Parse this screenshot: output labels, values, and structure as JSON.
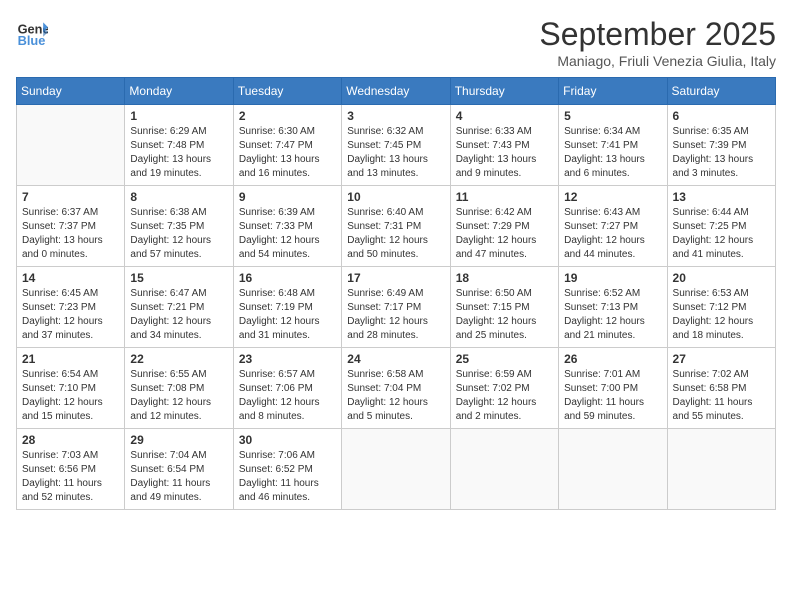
{
  "header": {
    "logo_general": "General",
    "logo_blue": "Blue",
    "month": "September 2025",
    "location": "Maniago, Friuli Venezia Giulia, Italy"
  },
  "days_of_week": [
    "Sunday",
    "Monday",
    "Tuesday",
    "Wednesday",
    "Thursday",
    "Friday",
    "Saturday"
  ],
  "weeks": [
    [
      {
        "day": "",
        "sunrise": "",
        "sunset": "",
        "daylight": ""
      },
      {
        "day": "1",
        "sunrise": "Sunrise: 6:29 AM",
        "sunset": "Sunset: 7:48 PM",
        "daylight": "Daylight: 13 hours and 19 minutes."
      },
      {
        "day": "2",
        "sunrise": "Sunrise: 6:30 AM",
        "sunset": "Sunset: 7:47 PM",
        "daylight": "Daylight: 13 hours and 16 minutes."
      },
      {
        "day": "3",
        "sunrise": "Sunrise: 6:32 AM",
        "sunset": "Sunset: 7:45 PM",
        "daylight": "Daylight: 13 hours and 13 minutes."
      },
      {
        "day": "4",
        "sunrise": "Sunrise: 6:33 AM",
        "sunset": "Sunset: 7:43 PM",
        "daylight": "Daylight: 13 hours and 9 minutes."
      },
      {
        "day": "5",
        "sunrise": "Sunrise: 6:34 AM",
        "sunset": "Sunset: 7:41 PM",
        "daylight": "Daylight: 13 hours and 6 minutes."
      },
      {
        "day": "6",
        "sunrise": "Sunrise: 6:35 AM",
        "sunset": "Sunset: 7:39 PM",
        "daylight": "Daylight: 13 hours and 3 minutes."
      }
    ],
    [
      {
        "day": "7",
        "sunrise": "Sunrise: 6:37 AM",
        "sunset": "Sunset: 7:37 PM",
        "daylight": "Daylight: 13 hours and 0 minutes."
      },
      {
        "day": "8",
        "sunrise": "Sunrise: 6:38 AM",
        "sunset": "Sunset: 7:35 PM",
        "daylight": "Daylight: 12 hours and 57 minutes."
      },
      {
        "day": "9",
        "sunrise": "Sunrise: 6:39 AM",
        "sunset": "Sunset: 7:33 PM",
        "daylight": "Daylight: 12 hours and 54 minutes."
      },
      {
        "day": "10",
        "sunrise": "Sunrise: 6:40 AM",
        "sunset": "Sunset: 7:31 PM",
        "daylight": "Daylight: 12 hours and 50 minutes."
      },
      {
        "day": "11",
        "sunrise": "Sunrise: 6:42 AM",
        "sunset": "Sunset: 7:29 PM",
        "daylight": "Daylight: 12 hours and 47 minutes."
      },
      {
        "day": "12",
        "sunrise": "Sunrise: 6:43 AM",
        "sunset": "Sunset: 7:27 PM",
        "daylight": "Daylight: 12 hours and 44 minutes."
      },
      {
        "day": "13",
        "sunrise": "Sunrise: 6:44 AM",
        "sunset": "Sunset: 7:25 PM",
        "daylight": "Daylight: 12 hours and 41 minutes."
      }
    ],
    [
      {
        "day": "14",
        "sunrise": "Sunrise: 6:45 AM",
        "sunset": "Sunset: 7:23 PM",
        "daylight": "Daylight: 12 hours and 37 minutes."
      },
      {
        "day": "15",
        "sunrise": "Sunrise: 6:47 AM",
        "sunset": "Sunset: 7:21 PM",
        "daylight": "Daylight: 12 hours and 34 minutes."
      },
      {
        "day": "16",
        "sunrise": "Sunrise: 6:48 AM",
        "sunset": "Sunset: 7:19 PM",
        "daylight": "Daylight: 12 hours and 31 minutes."
      },
      {
        "day": "17",
        "sunrise": "Sunrise: 6:49 AM",
        "sunset": "Sunset: 7:17 PM",
        "daylight": "Daylight: 12 hours and 28 minutes."
      },
      {
        "day": "18",
        "sunrise": "Sunrise: 6:50 AM",
        "sunset": "Sunset: 7:15 PM",
        "daylight": "Daylight: 12 hours and 25 minutes."
      },
      {
        "day": "19",
        "sunrise": "Sunrise: 6:52 AM",
        "sunset": "Sunset: 7:13 PM",
        "daylight": "Daylight: 12 hours and 21 minutes."
      },
      {
        "day": "20",
        "sunrise": "Sunrise: 6:53 AM",
        "sunset": "Sunset: 7:12 PM",
        "daylight": "Daylight: 12 hours and 18 minutes."
      }
    ],
    [
      {
        "day": "21",
        "sunrise": "Sunrise: 6:54 AM",
        "sunset": "Sunset: 7:10 PM",
        "daylight": "Daylight: 12 hours and 15 minutes."
      },
      {
        "day": "22",
        "sunrise": "Sunrise: 6:55 AM",
        "sunset": "Sunset: 7:08 PM",
        "daylight": "Daylight: 12 hours and 12 minutes."
      },
      {
        "day": "23",
        "sunrise": "Sunrise: 6:57 AM",
        "sunset": "Sunset: 7:06 PM",
        "daylight": "Daylight: 12 hours and 8 minutes."
      },
      {
        "day": "24",
        "sunrise": "Sunrise: 6:58 AM",
        "sunset": "Sunset: 7:04 PM",
        "daylight": "Daylight: 12 hours and 5 minutes."
      },
      {
        "day": "25",
        "sunrise": "Sunrise: 6:59 AM",
        "sunset": "Sunset: 7:02 PM",
        "daylight": "Daylight: 12 hours and 2 minutes."
      },
      {
        "day": "26",
        "sunrise": "Sunrise: 7:01 AM",
        "sunset": "Sunset: 7:00 PM",
        "daylight": "Daylight: 11 hours and 59 minutes."
      },
      {
        "day": "27",
        "sunrise": "Sunrise: 7:02 AM",
        "sunset": "Sunset: 6:58 PM",
        "daylight": "Daylight: 11 hours and 55 minutes."
      }
    ],
    [
      {
        "day": "28",
        "sunrise": "Sunrise: 7:03 AM",
        "sunset": "Sunset: 6:56 PM",
        "daylight": "Daylight: 11 hours and 52 minutes."
      },
      {
        "day": "29",
        "sunrise": "Sunrise: 7:04 AM",
        "sunset": "Sunset: 6:54 PM",
        "daylight": "Daylight: 11 hours and 49 minutes."
      },
      {
        "day": "30",
        "sunrise": "Sunrise: 7:06 AM",
        "sunset": "Sunset: 6:52 PM",
        "daylight": "Daylight: 11 hours and 46 minutes."
      },
      {
        "day": "",
        "sunrise": "",
        "sunset": "",
        "daylight": ""
      },
      {
        "day": "",
        "sunrise": "",
        "sunset": "",
        "daylight": ""
      },
      {
        "day": "",
        "sunrise": "",
        "sunset": "",
        "daylight": ""
      },
      {
        "day": "",
        "sunrise": "",
        "sunset": "",
        "daylight": ""
      }
    ]
  ]
}
